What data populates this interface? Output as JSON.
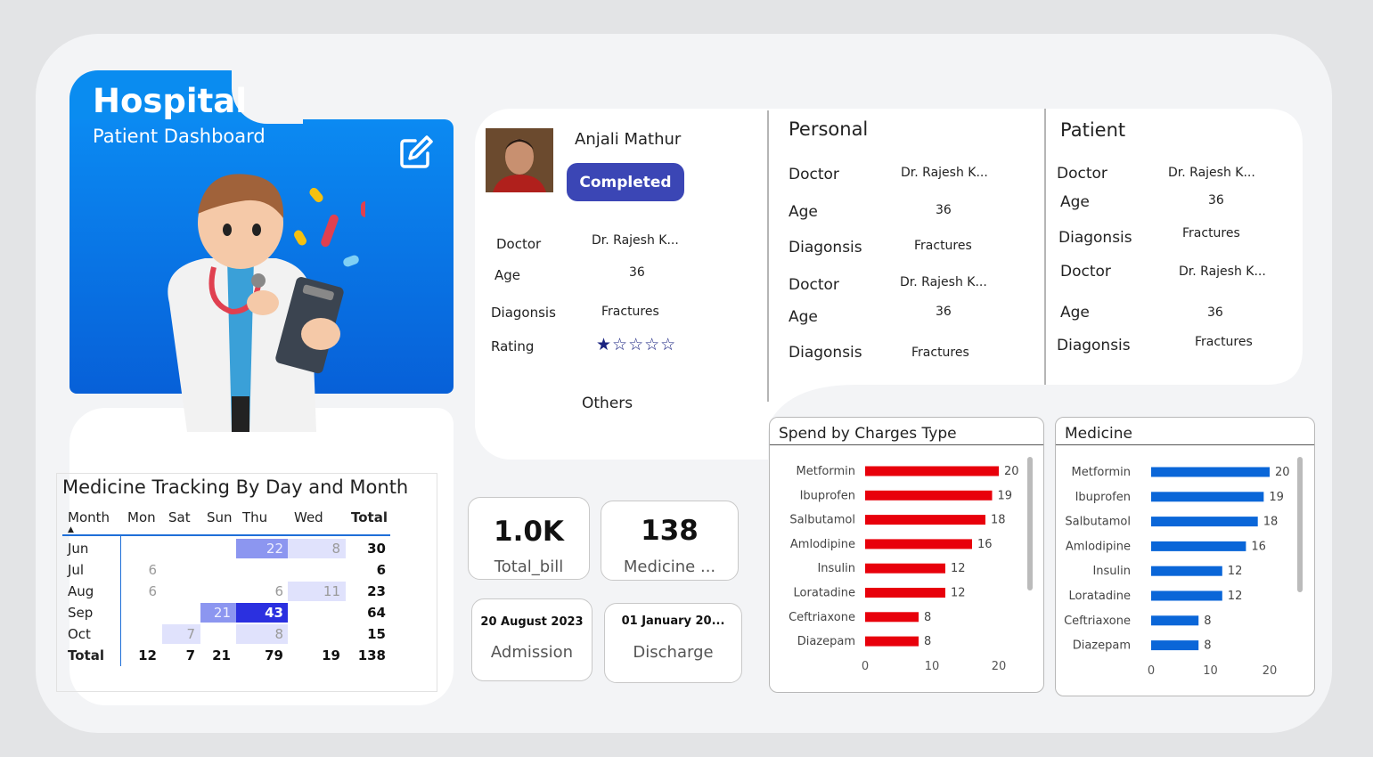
{
  "header": {
    "title": "Hospital",
    "subtitle": "Patient Dashboard",
    "edit_icon": "edit-icon"
  },
  "patient": {
    "name": "Anjali Mathur",
    "status": "Completed",
    "status_color": "#3b46b5",
    "fields": [
      {
        "label": "Doctor",
        "value": "Dr. Rajesh K..."
      },
      {
        "label": "Age",
        "value": "36"
      },
      {
        "label": "Diagonsis",
        "value": "Fractures"
      },
      {
        "label": "Rating",
        "value": "★☆☆☆☆"
      }
    ],
    "rating": 1,
    "rating_max": 5,
    "others_label": "Others"
  },
  "personal": {
    "title": "Personal",
    "fields": [
      {
        "label": "Doctor",
        "value": "Dr. Rajesh K..."
      },
      {
        "label": "Age",
        "value": "36"
      },
      {
        "label": "Diagonsis",
        "value": "Fractures"
      },
      {
        "label": "Doctor",
        "value": "Dr. Rajesh K..."
      },
      {
        "label": "Age",
        "value": "36"
      },
      {
        "label": "Diagonsis",
        "value": "Fractures"
      }
    ]
  },
  "patient_section": {
    "title": "Patient",
    "fields": [
      {
        "label": "Doctor",
        "value": "Dr. Rajesh K..."
      },
      {
        "label": "Age",
        "value": "36"
      },
      {
        "label": "Diagonsis",
        "value": "Fractures"
      },
      {
        "label": "Doctor",
        "value": "Dr. Rajesh K..."
      },
      {
        "label": "Age",
        "value": "36"
      },
      {
        "label": "Diagonsis",
        "value": "Fractures"
      }
    ]
  },
  "kpis": {
    "total_bill": {
      "value": "1.0K",
      "label": "Total_bill"
    },
    "medicine": {
      "value": "138",
      "label": "Medicine ..."
    },
    "admission": {
      "value": "20 August 2023",
      "label": "Admission"
    },
    "discharge": {
      "value": "01 January 20...",
      "label": "Discharge"
    }
  },
  "matrix": {
    "title": "Medicine Tracking By Day and Month",
    "columns": [
      "Month",
      "Mon",
      "Sat",
      "Sun",
      "Thu",
      "Wed",
      "Total"
    ],
    "rows": [
      {
        "month": "Jun",
        "Mon": "",
        "Sat": "",
        "Sun": "",
        "Thu": "22",
        "Wed": "8",
        "Total": "30"
      },
      {
        "month": "Jul",
        "Mon": "6",
        "Sat": "",
        "Sun": "",
        "Thu": "",
        "Wed": "",
        "Total": "6"
      },
      {
        "month": "Aug",
        "Mon": "6",
        "Sat": "",
        "Sun": "",
        "Thu": "6",
        "Wed": "11",
        "Total": "23"
      },
      {
        "month": "Sep",
        "Mon": "",
        "Sat": "",
        "Sun": "21",
        "Thu": "43",
        "Wed": "",
        "Total": "64"
      },
      {
        "month": "Oct",
        "Mon": "",
        "Sat": "7",
        "Sun": "",
        "Thu": "8",
        "Wed": "",
        "Total": "15"
      }
    ],
    "total_row": {
      "month": "Total",
      "Mon": "12",
      "Sat": "7",
      "Sun": "21",
      "Thu": "79",
      "Wed": "19",
      "Total": "138"
    }
  },
  "chart_data": [
    {
      "type": "bar",
      "orientation": "horizontal",
      "title": "Spend by Charges Type",
      "categories": [
        "Metformin",
        "Ibuprofen",
        "Salbutamol",
        "Amlodipine",
        "Insulin",
        "Loratadine",
        "Ceftriaxone",
        "Diazepam"
      ],
      "values": [
        20,
        19,
        18,
        16,
        12,
        12,
        8,
        8
      ],
      "color": "#e8000b",
      "xticks": [
        0,
        10,
        20
      ],
      "xlim": [
        0,
        22
      ]
    },
    {
      "type": "bar",
      "orientation": "horizontal",
      "title": "Medicine",
      "categories": [
        "Metformin",
        "Ibuprofen",
        "Salbutamol",
        "Amlodipine",
        "Insulin",
        "Loratadine",
        "Ceftriaxone",
        "Diazepam"
      ],
      "values": [
        20,
        19,
        18,
        16,
        12,
        12,
        8,
        8
      ],
      "color": "#0a66d8",
      "xticks": [
        0,
        10,
        20
      ],
      "xlim": [
        0,
        22
      ]
    }
  ]
}
